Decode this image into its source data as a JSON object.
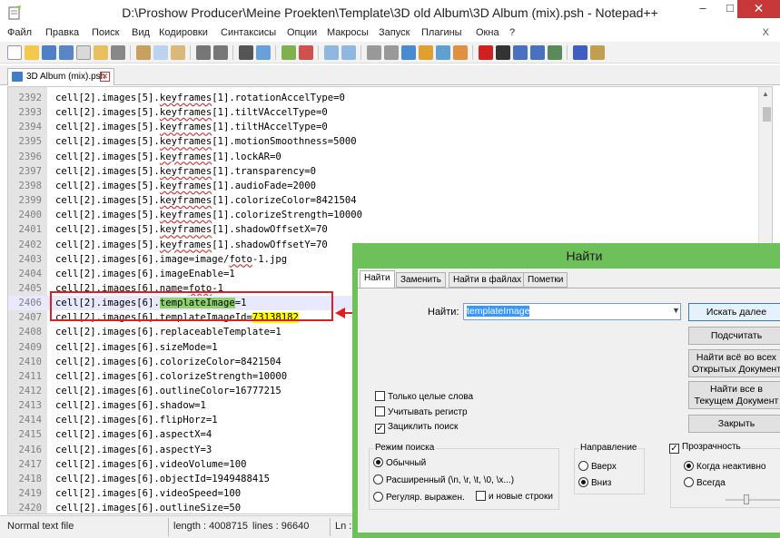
{
  "window": {
    "title": "D:\\Proshow Producer\\Meine Proekten\\Template\\3D old Album\\3D Album (mix).psh - Notepad++",
    "min_glyph": "–",
    "max_glyph": "□",
    "close_glyph": "✕"
  },
  "menu": {
    "items": [
      "Файл",
      "Правка",
      "Поиск",
      "Вид",
      "Кодировки",
      "Синтаксисы",
      "Опции",
      "Макросы",
      "Запуск",
      "Плагины",
      "Окна",
      "?"
    ],
    "close": "X"
  },
  "tab": {
    "label": "3D Album (mix).psh",
    "close_glyph": "✕"
  },
  "editor": {
    "lines": [
      {
        "num": "2392",
        "pre": "cell[2].images[5].",
        "kw": "keyframes",
        "post": "[1].rotationAccelType=0"
      },
      {
        "num": "2393",
        "pre": "cell[2].images[5].",
        "kw": "keyframes",
        "post": "[1].tiltVAccelType=0"
      },
      {
        "num": "2394",
        "pre": "cell[2].images[5].",
        "kw": "keyframes",
        "post": "[1].tiltHAccelType=0"
      },
      {
        "num": "2395",
        "pre": "cell[2].images[5].",
        "kw": "keyframes",
        "post": "[1].motionSmoothness=5000"
      },
      {
        "num": "2396",
        "pre": "cell[2].images[5].",
        "kw": "keyframes",
        "post": "[1].lockAR=0"
      },
      {
        "num": "2397",
        "pre": "cell[2].images[5].",
        "kw": "keyframes",
        "post": "[1].transparency=0"
      },
      {
        "num": "2398",
        "pre": "cell[2].images[5].",
        "kw": "keyframes",
        "post": "[1].audioFade=2000"
      },
      {
        "num": "2399",
        "pre": "cell[2].images[5].",
        "kw": "keyframes",
        "post": "[1].colorizeColor=8421504"
      },
      {
        "num": "2400",
        "pre": "cell[2].images[5].",
        "kw": "keyframes",
        "post": "[1].colorizeStrength=10000"
      },
      {
        "num": "2401",
        "pre": "cell[2].images[5].",
        "kw": "keyframes",
        "post": "[1].shadowOffsetX=70"
      },
      {
        "num": "2402",
        "pre": "cell[2].images[5].",
        "kw": "keyframes",
        "post": "[1].shadowOffsetY=70"
      },
      {
        "num": "2403",
        "pre": "cell[2].images[6].image=image/",
        "kw": "foto",
        "post": "-1.jpg"
      },
      {
        "num": "2404",
        "pre": "cell[2].images[6].imageEnable=1",
        "kw": "",
        "post": ""
      },
      {
        "num": "2405",
        "pre": "cell[2].images[6].name=",
        "kw": "foto",
        "post": "-1"
      },
      {
        "num": "2406",
        "pre": "cell[2].images[6].",
        "green": "templateImage",
        "post": "=1",
        "kw": "",
        "hl": true
      },
      {
        "num": "2407",
        "pre": "cell[2].images[6].templateImageId=",
        "yellow": "73138182",
        "kw": "",
        "post": ""
      },
      {
        "num": "2408",
        "pre": "cell[2].images[6].replaceableTemplate=1",
        "kw": "",
        "post": ""
      },
      {
        "num": "2409",
        "pre": "cell[2].images[6].sizeMode=1",
        "kw": "",
        "post": ""
      },
      {
        "num": "2410",
        "pre": "cell[2].images[6].colorizeColor=8421504",
        "kw": "",
        "post": ""
      },
      {
        "num": "2411",
        "pre": "cell[2].images[6].colorizeStrength=10000",
        "kw": "",
        "post": ""
      },
      {
        "num": "2412",
        "pre": "cell[2].images[6].outlineColor=16777215",
        "kw": "",
        "post": ""
      },
      {
        "num": "2413",
        "pre": "cell[2].images[6].shadow=1",
        "kw": "",
        "post": ""
      },
      {
        "num": "2414",
        "pre": "cell[2].images[6].flipHorz=1",
        "kw": "",
        "post": ""
      },
      {
        "num": "2415",
        "pre": "cell[2].images[6].aspectX=4",
        "kw": "",
        "post": ""
      },
      {
        "num": "2416",
        "pre": "cell[2].images[6].aspectY=3",
        "kw": "",
        "post": ""
      },
      {
        "num": "2417",
        "pre": "cell[2].images[6].videoVolume=100",
        "kw": "",
        "post": ""
      },
      {
        "num": "2418",
        "pre": "cell[2].images[6].objectId=1949488415",
        "kw": "",
        "post": ""
      },
      {
        "num": "2419",
        "pre": "cell[2].images[6].videoSpeed=100",
        "kw": "",
        "post": ""
      },
      {
        "num": "2420",
        "pre": "cell[2].images[6].outlineSize=50",
        "kw": "",
        "post": ""
      }
    ]
  },
  "statusbar": {
    "type": "Normal text file",
    "length": "length : 4008715",
    "lines": "lines : 96640",
    "ln": "Ln :"
  },
  "find_dialog": {
    "title": "Найти",
    "tabs": [
      "Найти",
      "Заменить",
      "Найти в файлах",
      "Пометки"
    ],
    "find_label": "Найти:",
    "find_value": "templateImage",
    "buttons": {
      "find_next": "Искать далее",
      "count": "Подсчитать",
      "find_all_open_1": "Найти всё во всех",
      "find_all_open_2": "Открытых Документ",
      "find_all_current_1": "Найти все в",
      "find_all_current_2": "Текущем Документ",
      "close": "Закрыть"
    },
    "checks": {
      "whole_word": "Только целые слова",
      "match_case": "Учитывать регистр",
      "wrap": "Зациклить поиск"
    },
    "search_mode": {
      "label": "Режим поиска",
      "normal": "Обычный",
      "extended": "Расширенный (\\n, \\r, \\t, \\0, \\x...)",
      "regex": "Регуляр. выражен.",
      "newlines": "и новые строки"
    },
    "direction": {
      "label": "Направление",
      "up": "Вверх",
      "down": "Вниз"
    },
    "transparency": {
      "label": "Прозрачность",
      "inactive": "Когда неактивно",
      "always": "Всегда"
    }
  }
}
